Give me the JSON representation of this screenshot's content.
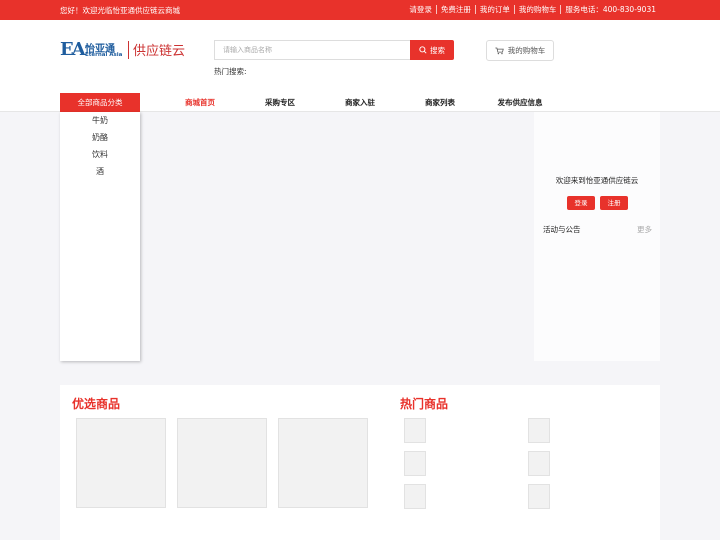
{
  "topbar": {
    "welcome": "您好！欢迎光临怡亚通供应链云商城",
    "links": [
      "请登录",
      "免费注册",
      "我的订单",
      "我的购物车",
      "服务电话：400-830-9031"
    ]
  },
  "logo": {
    "mark": "EA",
    "cn": "怡亚通",
    "en": "Eternal Asia",
    "brand2": "供应链云"
  },
  "search": {
    "placeholder": "请输入商品名称",
    "button": "搜索",
    "hot_label": "热门搜索:"
  },
  "cart": {
    "label": "我的购物车"
  },
  "category": {
    "header": "全部商品分类",
    "items": [
      "牛奶",
      "奶酪",
      "饮料",
      "酒"
    ]
  },
  "nav": {
    "items": [
      "商城首页",
      "采购专区",
      "商家入驻",
      "商家列表",
      "发布供应信息"
    ]
  },
  "user_panel": {
    "welcome": "欢迎来到怡亚通供应链云",
    "login": "登录",
    "register": "注册",
    "notice": "活动与公告",
    "more": "更多"
  },
  "sections": {
    "featured": "优选商品",
    "hot": "热门商品"
  },
  "colors": {
    "accent": "#e8322b",
    "logo_blue": "#1f5d9e"
  }
}
